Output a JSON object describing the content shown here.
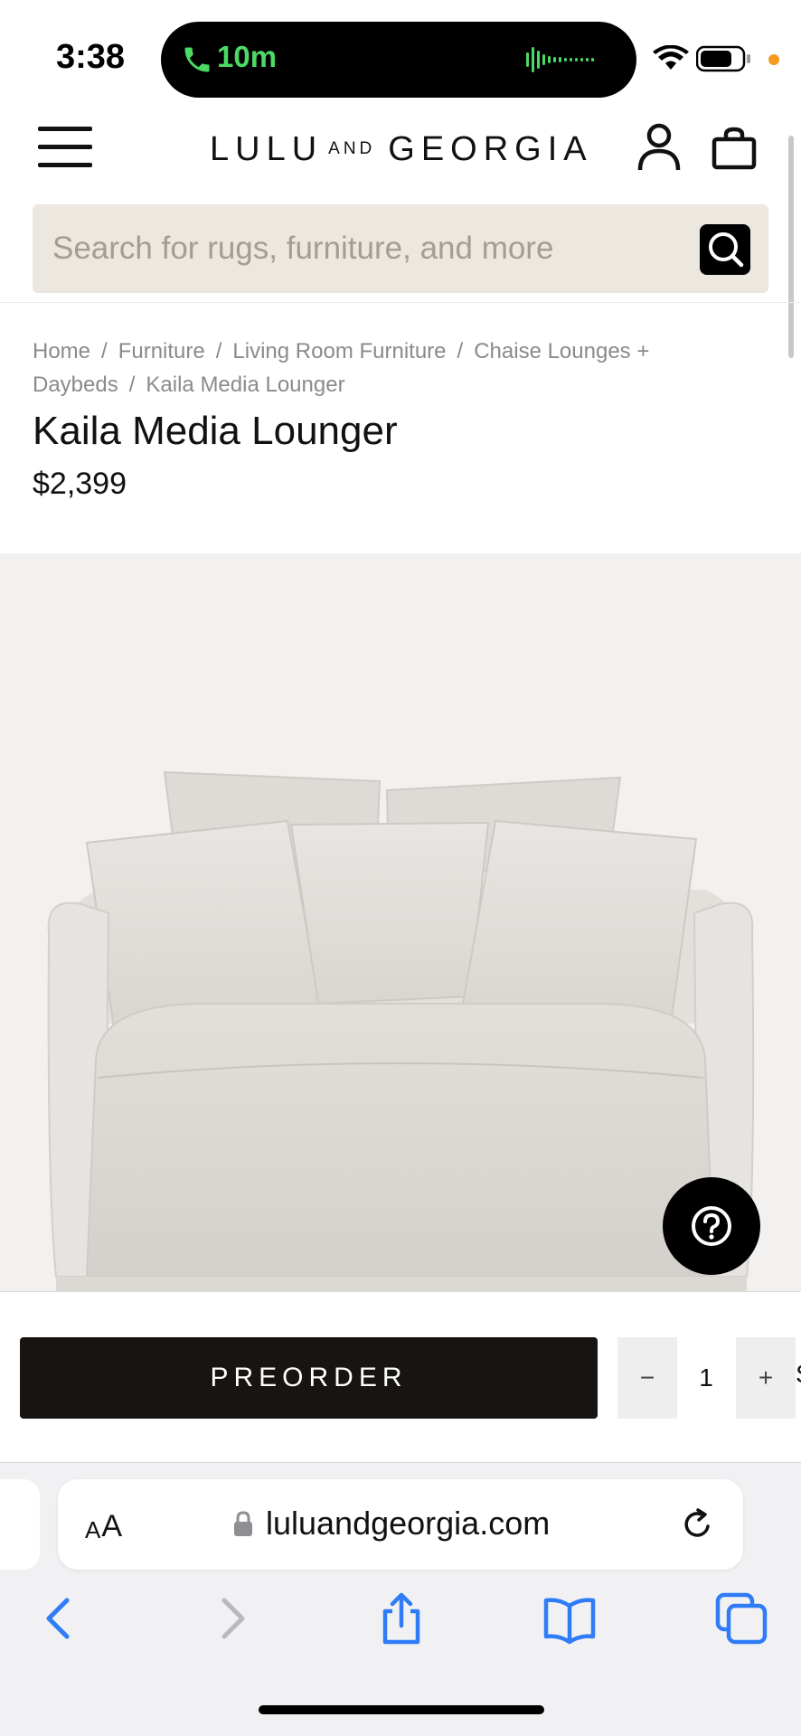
{
  "status_bar": {
    "time": "3:38",
    "call_duration": "10m",
    "call_color": "#4cd964",
    "privacy_dot_color": "#f29b1d"
  },
  "header": {
    "logo_left": "LULU",
    "logo_middle": "AND",
    "logo_right": "GEORGIA",
    "icons": [
      "menu-icon",
      "account-icon",
      "bag-icon"
    ]
  },
  "search": {
    "placeholder": "Search for rugs, furniture, and more",
    "value": "",
    "background": "#ece7df"
  },
  "breadcrumb": {
    "items": [
      "Home",
      "Furniture",
      "Living Room Furniture",
      "Chaise Lounges + Daybeds",
      "Kaila Media Lounger"
    ],
    "separator": "/"
  },
  "product": {
    "title": "Kaila Media Lounger",
    "price": "$2,399",
    "image_description_icon": "sofa-image"
  },
  "purchase": {
    "button_label": "PREORDER",
    "quantity": "1",
    "minus_label": "−",
    "plus_label": "+",
    "edge_char": "S"
  },
  "browser": {
    "text_size_small": "A",
    "text_size_large": "A",
    "url": "luluandgeorgia.com",
    "toolbar_icons": [
      "back-icon",
      "forward-icon",
      "share-icon",
      "bookmarks-icon",
      "tabs-icon"
    ],
    "accent_color": "#2f7cf6"
  }
}
